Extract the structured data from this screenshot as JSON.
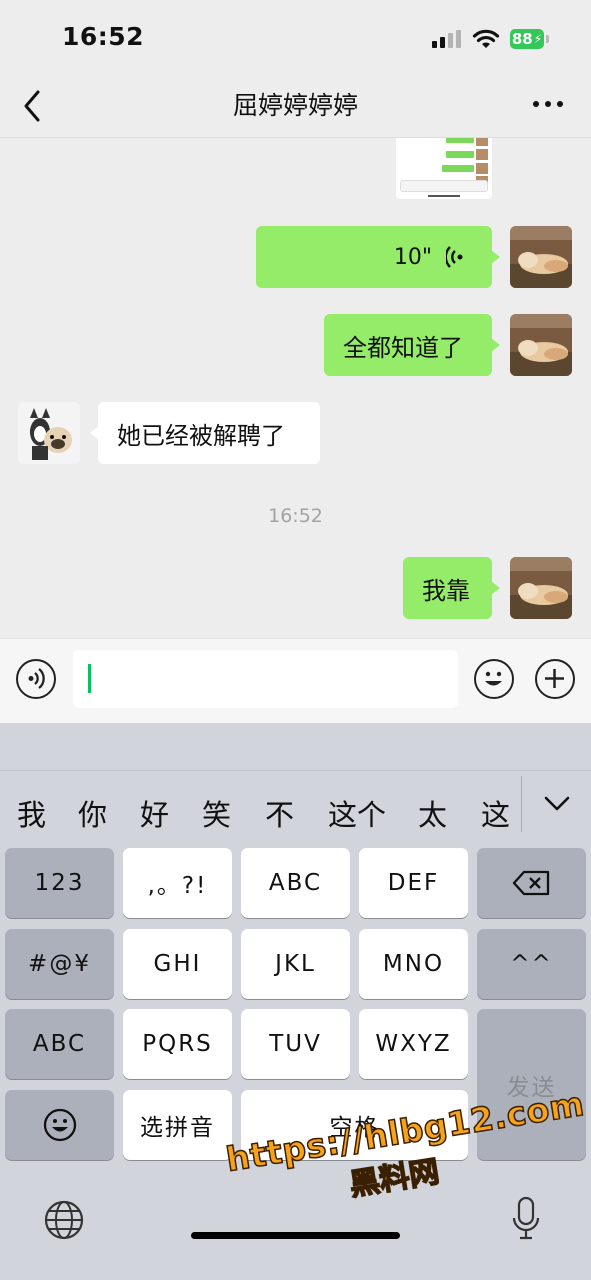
{
  "status_bar": {
    "time": "16:52",
    "battery": "88"
  },
  "header": {
    "title": "屈婷婷婷婷"
  },
  "messages": {
    "voice_duration": "10\"",
    "msg_1": "全都知道了",
    "msg_2": "她已经被解聘了",
    "timestamp": "16:52",
    "msg_3": "我靠"
  },
  "keyboard": {
    "candidates": [
      "我",
      "你",
      "好",
      "笑",
      "不",
      "这个",
      "太",
      "这"
    ],
    "keys": {
      "num": "123",
      "punct": ",。?!",
      "abc_t9": "ABC",
      "def": "DEF",
      "symbols": "#@¥",
      "ghi": "GHI",
      "jkl": "JKL",
      "mno": "MNO",
      "face": "^^",
      "abc_switch": "ABC",
      "pqrs": "PQRS",
      "tuv": "TUV",
      "wxyz": "WXYZ",
      "send": "发送",
      "pinyin": "选拼音",
      "space": "空格"
    }
  },
  "watermark": {
    "line1": "https://hlbg12.com",
    "line2": "黑料网"
  },
  "colors": {
    "bubble_green": "#95ec69",
    "caret": "#07c160",
    "battery": "#34c759"
  }
}
